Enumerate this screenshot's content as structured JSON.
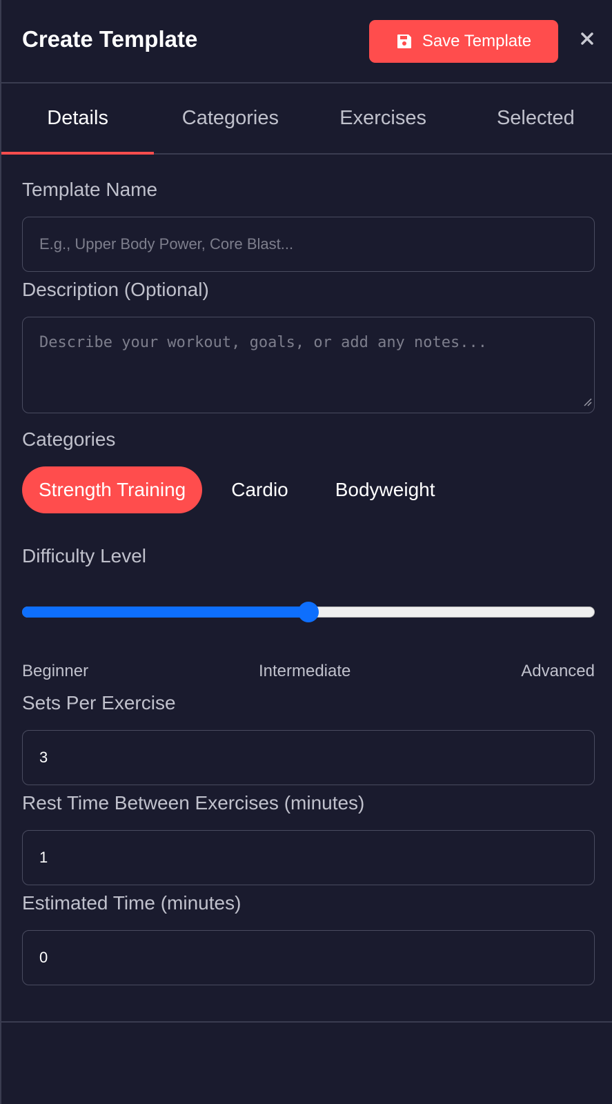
{
  "header": {
    "title": "Create Template",
    "save_label": "Save Template",
    "close_label": "×"
  },
  "tabs": [
    {
      "label": "Details",
      "active": true
    },
    {
      "label": "Categories",
      "active": false
    },
    {
      "label": "Exercises",
      "active": false
    },
    {
      "label": "Selected",
      "active": false
    }
  ],
  "form": {
    "template_name": {
      "label": "Template Name",
      "placeholder": "E.g., Upper Body Power, Core Blast...",
      "value": ""
    },
    "description": {
      "label": "Description (Optional)",
      "placeholder": "Describe your workout, goals, or add any notes...",
      "value": ""
    },
    "categories": {
      "label": "Categories",
      "options": [
        {
          "label": "Strength Training",
          "selected": true
        },
        {
          "label": "Cardio",
          "selected": false
        },
        {
          "label": "Bodyweight",
          "selected": false
        }
      ]
    },
    "difficulty": {
      "label": "Difficulty Level",
      "level": 0.5,
      "options": [
        "Beginner",
        "Intermediate",
        "Advanced"
      ]
    },
    "sets_per_exercise": {
      "label": "Sets Per Exercise",
      "value": "3"
    },
    "rest_time": {
      "label": "Rest Time Between Exercises (minutes)",
      "value": "1"
    },
    "estimated_time": {
      "label": "Estimated Time (minutes)",
      "value": "0"
    }
  },
  "colors": {
    "background": "#1a1b2e",
    "accent": "#ff4d4d",
    "slider": "#0e6ffd"
  },
  "icons": {
    "save": "floppy-disk-icon",
    "close": "close-icon",
    "resize": "resize-handle-icon"
  }
}
